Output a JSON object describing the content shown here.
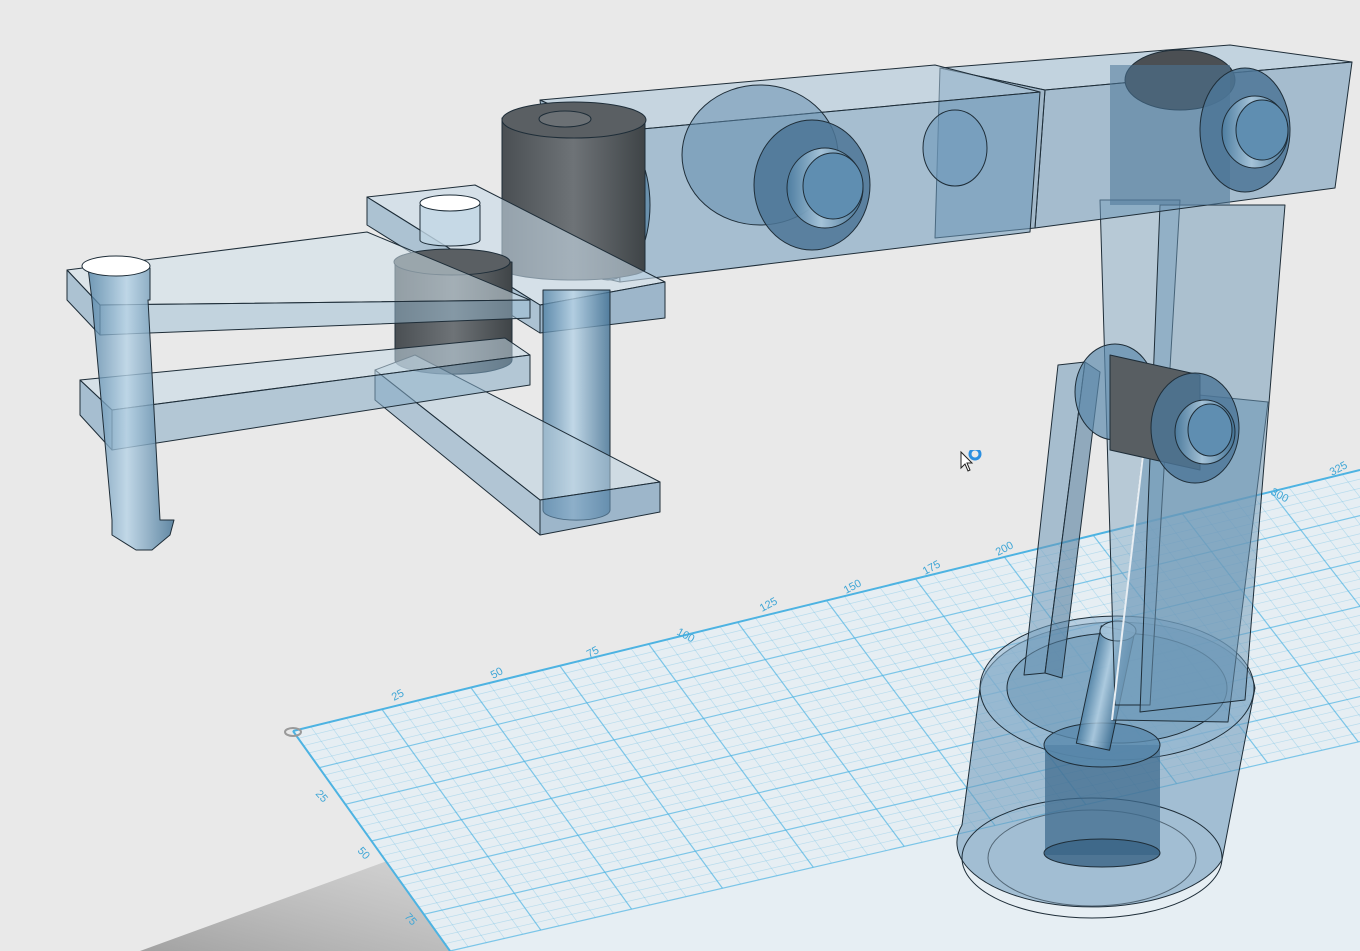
{
  "app": {
    "view": "3D workplane",
    "grid_color": "#4db3e2",
    "part_color": "#6f99b8",
    "dark_part_color": "#555a5e"
  },
  "grid": {
    "x_ticks": [
      "25",
      "50",
      "75",
      "100",
      "125",
      "150",
      "175",
      "200",
      "300",
      "325"
    ],
    "y_ticks": [
      "25",
      "50",
      "75"
    ]
  },
  "model": {
    "parts": [
      "base-cylinder",
      "lower-arm",
      "elbow-joint",
      "upper-arm-left",
      "upper-arm-right",
      "shoulder-cylinder",
      "wrist-bracket",
      "forearm-upper-plate",
      "forearm-lower-plate",
      "pen-tool",
      "support-post"
    ]
  },
  "cursor": {
    "icon": "arrow-cursor-with-busy-indicator"
  }
}
